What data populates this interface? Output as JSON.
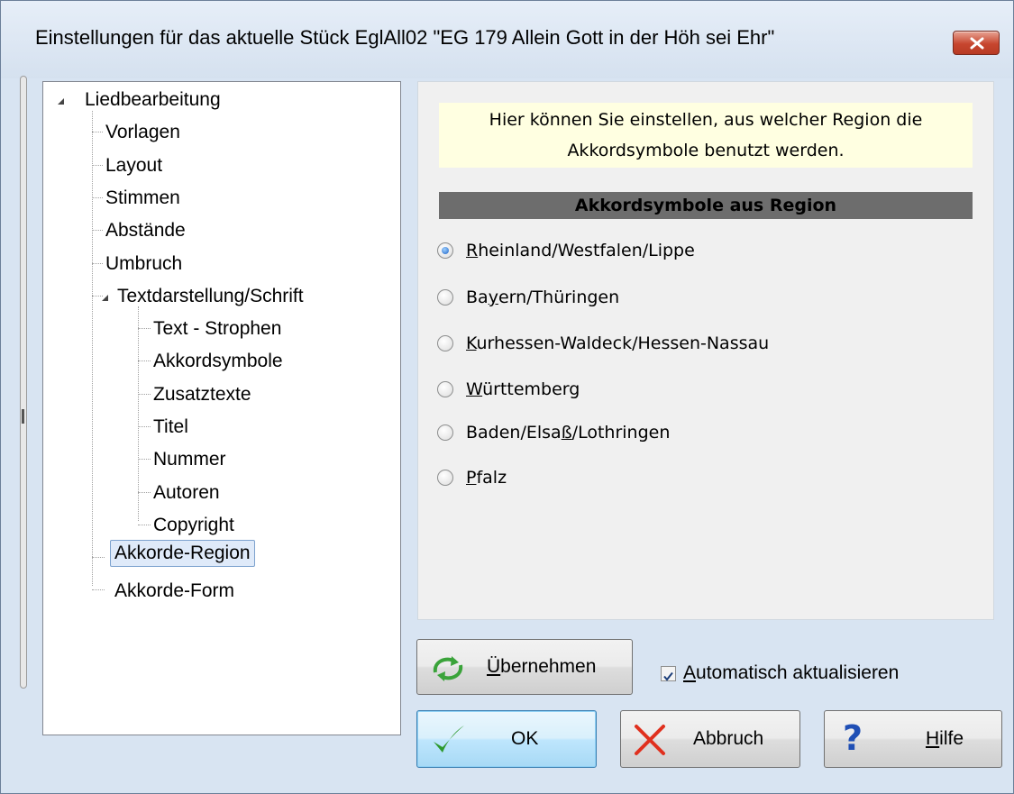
{
  "window": {
    "title": "Einstellungen für das aktuelle Stück EglAll02  \"EG 179 Allein Gott in der Höh sei Ehr\""
  },
  "tree": {
    "items": [
      {
        "label": "Liedbearbeitung"
      },
      {
        "label": "Vorlagen"
      },
      {
        "label": "Layout"
      },
      {
        "label": "Stimmen"
      },
      {
        "label": "Abstände"
      },
      {
        "label": "Umbruch"
      },
      {
        "label": "Textdarstellung/Schrift"
      },
      {
        "label": "Text - Strophen"
      },
      {
        "label": "Akkordsymbole"
      },
      {
        "label": "Zusatztexte"
      },
      {
        "label": "Titel"
      },
      {
        "label": "Nummer"
      },
      {
        "label": "Autoren"
      },
      {
        "label": "Copyright"
      },
      {
        "label": "Akkorde-Region"
      },
      {
        "label": "Akkorde-Form"
      }
    ],
    "selected": "Akkorde-Region"
  },
  "info": {
    "line1": "Hier können Sie einstellen, aus welcher Region die",
    "line2": "Akkordsymbole benutzt werden."
  },
  "region": {
    "header": "Akkordsymbole aus Region",
    "options": [
      {
        "pre": "",
        "key": "R",
        "post": "heinland/Westfalen/Lippe",
        "checked": true
      },
      {
        "pre": "Ba",
        "key": "y",
        "post": "ern/Thüringen",
        "checked": false
      },
      {
        "pre": "",
        "key": "K",
        "post": "urhessen-Waldeck/Hessen-Nassau",
        "checked": false
      },
      {
        "pre": "",
        "key": "W",
        "post": "ürttemberg",
        "checked": false
      },
      {
        "pre": "Baden/Elsa",
        "key": "ß",
        "post": "/Lothringen",
        "checked": false
      },
      {
        "pre": "",
        "key": "P",
        "post": "falz",
        "checked": false
      }
    ]
  },
  "buttons": {
    "apply": {
      "key": "Ü",
      "rest": "bernehmen"
    },
    "auto_update": {
      "key": "A",
      "rest": "utomatisch aktualisieren",
      "checked": true
    },
    "ok": "OK",
    "cancel": "Abbruch",
    "help": {
      "key": "H",
      "rest": "ilfe"
    }
  },
  "colors": {
    "title_bar": "#dbe6f3",
    "close_button": "#c7462f",
    "info_background": "#ffffe1",
    "header_background": "#6d6d6d",
    "ok_check": "#2e9a2e",
    "cancel_x": "#e0301e",
    "help_question": "#1f4fb5"
  }
}
